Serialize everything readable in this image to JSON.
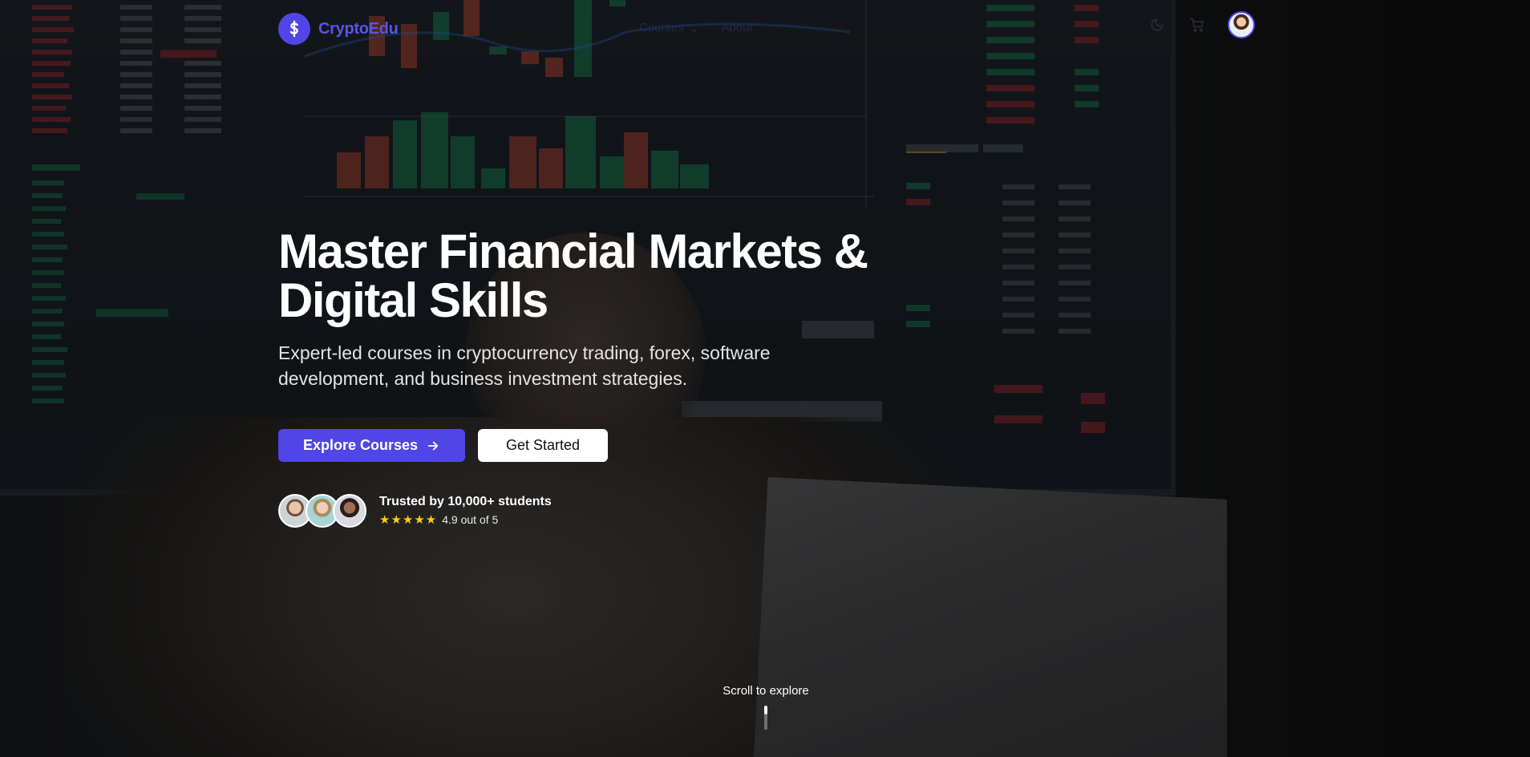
{
  "brand": {
    "name": "CryptoEdu",
    "logo_icon": "dollar-s-icon"
  },
  "nav": {
    "items": [
      "Courses",
      "About"
    ]
  },
  "header_icons": [
    "moon-icon",
    "cart-icon",
    "user-avatar"
  ],
  "hero": {
    "title_line1": "Master Financial Markets &",
    "title_line2": "Digital Skills",
    "subtitle": "Expert-led courses in cryptocurrency trading, forex, software development, and business investment strategies.",
    "primary_cta": "Explore Courses",
    "secondary_cta": "Get Started"
  },
  "social_proof": {
    "title": "Trusted by 10,000+ students",
    "stars": 5,
    "rating_text": "4.9 out of 5"
  },
  "scroll_hint": "Scroll to explore",
  "colors": {
    "accent": "#4f46e5",
    "star": "#facc15",
    "overlay": "#000000"
  }
}
